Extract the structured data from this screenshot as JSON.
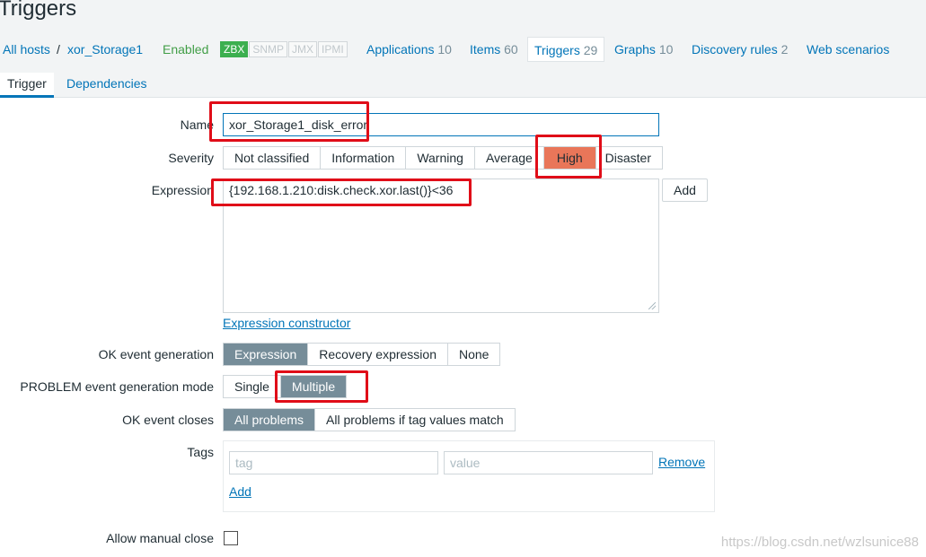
{
  "page": {
    "title": "Triggers"
  },
  "host_nav": {
    "all_hosts": "All hosts",
    "separator": "/",
    "host_name": "xor_Storage1",
    "status": "Enabled",
    "availability": [
      "ZBX",
      "SNMP",
      "JMX",
      "IPMI"
    ],
    "links": [
      {
        "label": "Applications",
        "count": "10"
      },
      {
        "label": "Items",
        "count": "60"
      },
      {
        "label": "Triggers",
        "count": "29"
      },
      {
        "label": "Graphs",
        "count": "10"
      },
      {
        "label": "Discovery rules",
        "count": "2"
      },
      {
        "label": "Web scenarios",
        "count": ""
      }
    ]
  },
  "form_tabs": [
    "Trigger",
    "Dependencies"
  ],
  "form": {
    "name_label": "Name",
    "name_value": "xor_Storage1_disk_error",
    "severity_label": "Severity",
    "severity_options": [
      "Not classified",
      "Information",
      "Warning",
      "Average",
      "High",
      "Disaster"
    ],
    "severity_selected": "High",
    "expression_label": "Expression",
    "expression_value": "{192.168.1.210:disk.check.xor.last()}<36",
    "add_button": "Add",
    "expression_constructor": "Expression constructor",
    "ok_event_generation_label": "OK event generation",
    "ok_event_generation_options": [
      "Expression",
      "Recovery expression",
      "None"
    ],
    "ok_event_generation_selected": "Expression",
    "problem_mode_label": "PROBLEM event generation mode",
    "problem_mode_options": [
      "Single",
      "Multiple"
    ],
    "problem_mode_selected": "Multiple",
    "ok_event_closes_label": "OK event closes",
    "ok_event_closes_options": [
      "All problems",
      "All problems if tag values match"
    ],
    "ok_event_closes_selected": "All problems",
    "tags_label": "Tags",
    "tag_placeholder": "tag",
    "value_placeholder": "value",
    "remove_link": "Remove",
    "add_tag_link": "Add",
    "allow_manual_close_label": "Allow manual close"
  },
  "watermark": "https://blog.csdn.net/wzlsunice88",
  "colors": {
    "link": "#0275b8",
    "selected": "#768d99",
    "high": "#e97659",
    "annotation": "#e00d18"
  }
}
